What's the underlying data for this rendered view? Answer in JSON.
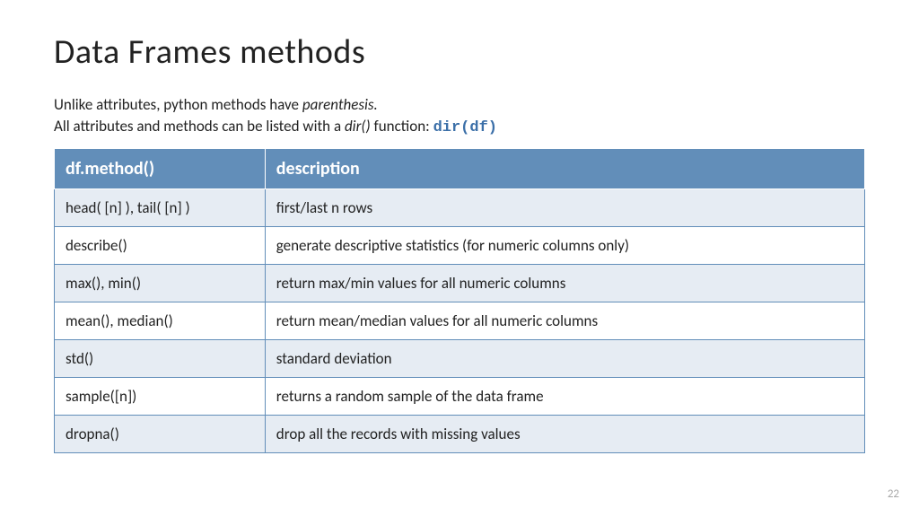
{
  "title": "Data Frames methods",
  "subtitle": {
    "line1_a": "Unlike attributes, python methods have ",
    "line1_b": "parenthesis.",
    "line2_a": "All attributes and methods can be listed with a ",
    "line2_b": "dir()",
    "line2_c": " function: ",
    "line2_d": "dir(df)"
  },
  "table": {
    "headers": {
      "col1": "df.method()",
      "col2": "description"
    },
    "rows": [
      {
        "method": "head( [n] ), tail( [n] )",
        "desc": "first/last n rows"
      },
      {
        "method": "describe()",
        "desc": "generate descriptive statistics (for numeric columns only)"
      },
      {
        "method": "max(), min()",
        "desc": "return max/min values for all numeric columns"
      },
      {
        "method": "mean(), median()",
        "desc": "return mean/median values for all numeric columns"
      },
      {
        "method": "std()",
        "desc": "standard deviation"
      },
      {
        "method": "sample([n])",
        "desc": "returns a random sample of the data frame"
      },
      {
        "method": "dropna()",
        "desc": "drop all the records with missing values"
      }
    ]
  },
  "page_number": "22"
}
